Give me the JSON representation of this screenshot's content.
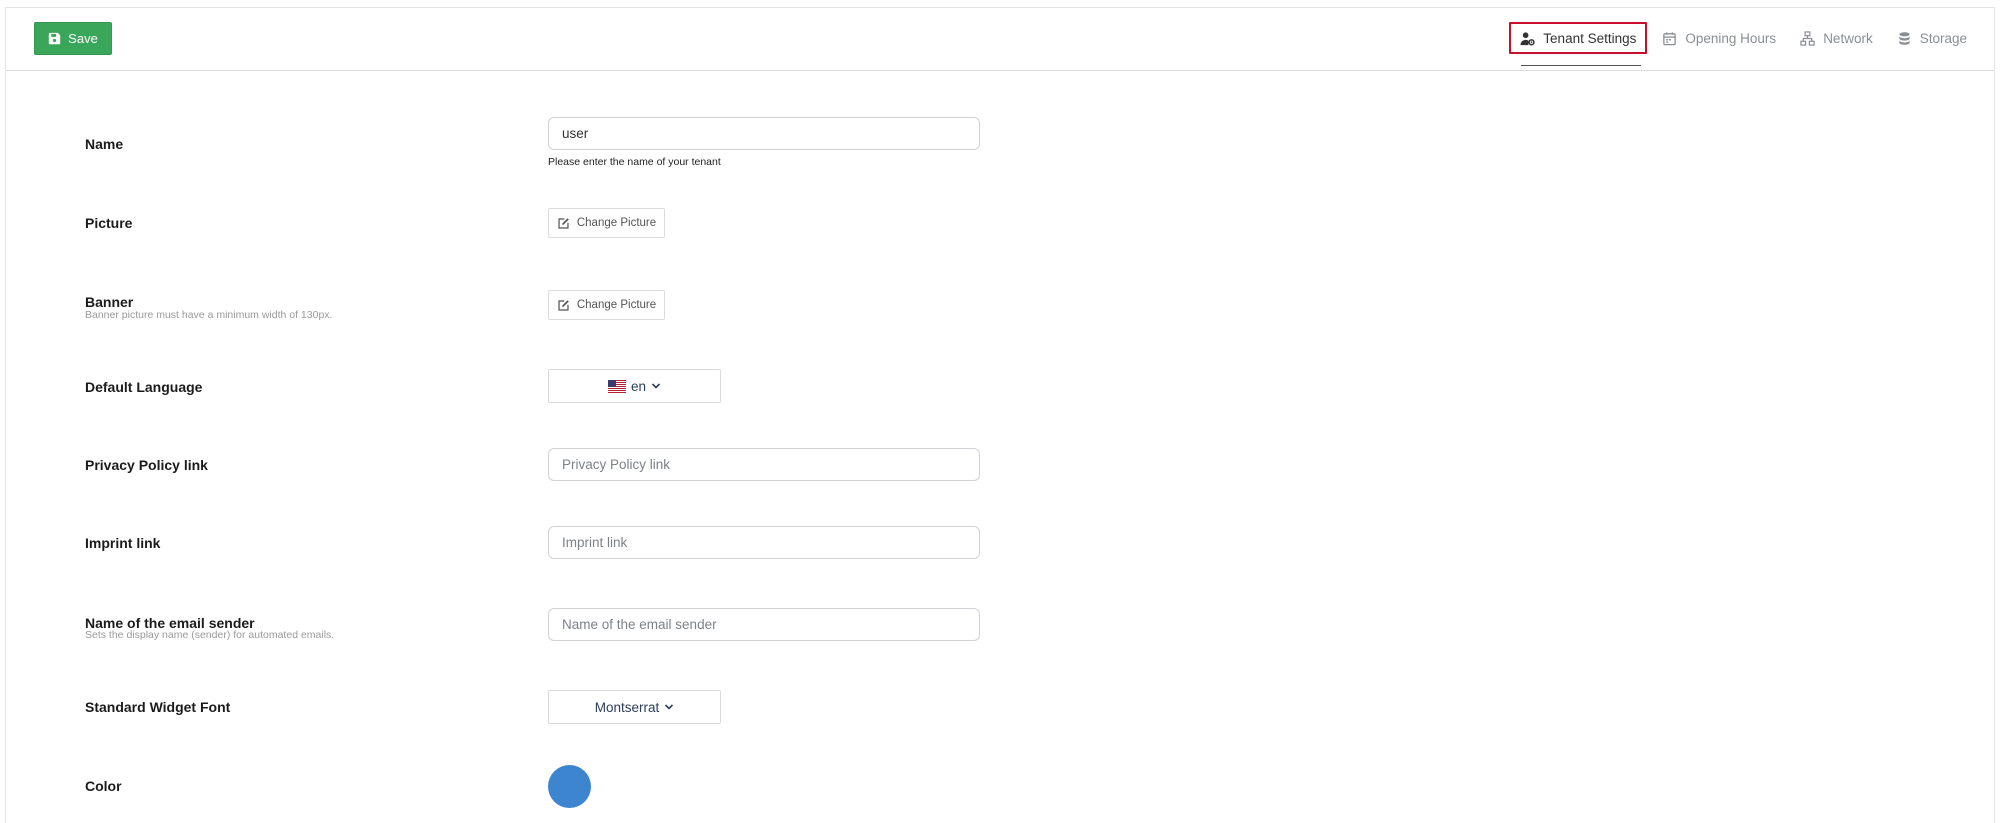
{
  "toolbar": {
    "save_label": "Save"
  },
  "tabs": [
    {
      "label": "Tenant Settings",
      "icon": "user-gear-icon",
      "active": true
    },
    {
      "label": "Opening Hours",
      "icon": "calendar-icon",
      "active": false
    },
    {
      "label": "Network",
      "icon": "network-icon",
      "active": false
    },
    {
      "label": "Storage",
      "icon": "database-icon",
      "active": false
    }
  ],
  "form": {
    "name": {
      "label": "Name",
      "value": "user",
      "help": "Please enter the name of your tenant"
    },
    "picture": {
      "label": "Picture",
      "button": "Change Picture"
    },
    "banner": {
      "label": "Banner",
      "hint": "Banner picture must have a minimum width of 130px.",
      "button": "Change Picture"
    },
    "language": {
      "label": "Default Language",
      "value": "en"
    },
    "privacy": {
      "label": "Privacy Policy link",
      "placeholder": "Privacy Policy link"
    },
    "imprint": {
      "label": "Imprint link",
      "placeholder": "Imprint link"
    },
    "email_sender": {
      "label": "Name of the email sender",
      "hint": "Sets the display name (sender) for automated emails.",
      "placeholder": "Name of the email sender"
    },
    "font": {
      "label": "Standard Widget Font",
      "value": "Montserrat"
    },
    "color": {
      "label": "Color",
      "value": "#3d85cf"
    }
  }
}
